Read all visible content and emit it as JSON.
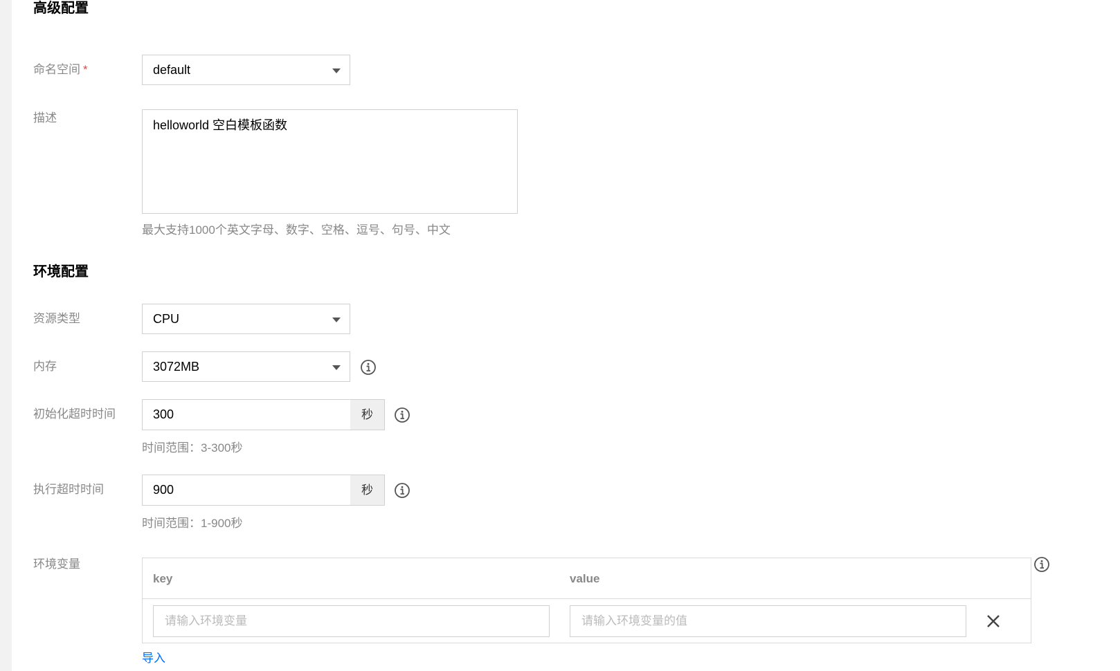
{
  "advanced": {
    "title": "高级配置",
    "namespace": {
      "label": "命名空间",
      "required_mark": "*",
      "value": "default"
    },
    "description": {
      "label": "描述",
      "value": "helloworld 空白模板函数",
      "hint": "最大支持1000个英文字母、数字、空格、逗号、句号、中文"
    }
  },
  "environment": {
    "title": "环境配置",
    "resource_type": {
      "label": "资源类型",
      "value": "CPU"
    },
    "memory": {
      "label": "内存",
      "value": "3072MB"
    },
    "init_timeout": {
      "label": "初始化超时时间",
      "value": "300",
      "suffix": "秒",
      "hint": "时间范围：3-300秒"
    },
    "exec_timeout": {
      "label": "执行超时时间",
      "value": "900",
      "suffix": "秒",
      "hint": "时间范围：1-900秒"
    },
    "env_vars": {
      "label": "环境变量",
      "col_key": "key",
      "col_value": "value",
      "key_placeholder": "请输入环境变量",
      "value_placeholder": "请输入环境变量的值",
      "import_label": "导入"
    }
  },
  "colors": {
    "link": "#006eff",
    "required": "#e54545",
    "label": "#888888"
  },
  "icons": {
    "info": "info-circle-icon",
    "remove": "close-icon",
    "dropdown": "caret-down-icon"
  }
}
